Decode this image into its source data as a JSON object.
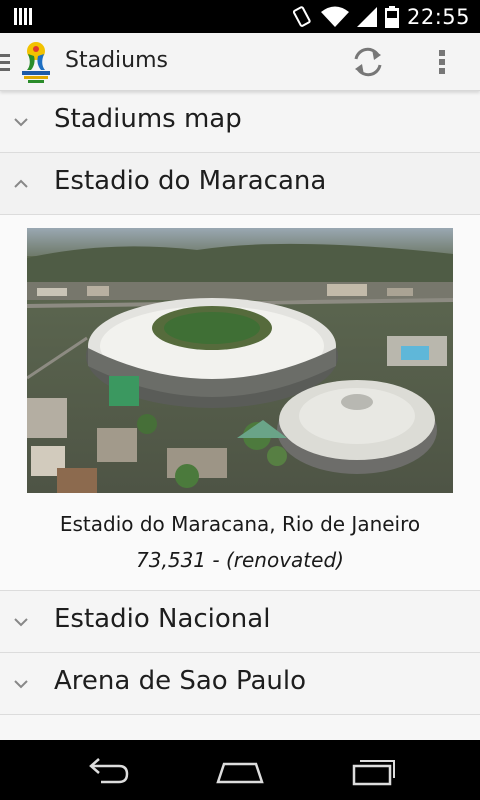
{
  "status_bar": {
    "time": "22:55",
    "icons": [
      "notification-icon",
      "vibrate-icon",
      "wifi-icon",
      "signal-icon",
      "battery-icon"
    ]
  },
  "action_bar": {
    "title": "Stadiums",
    "logo_icon": "fifa-world-cup-logo",
    "actions": [
      "refresh-icon",
      "overflow-menu-icon"
    ]
  },
  "stadiums": {
    "items": [
      {
        "label": "Stadiums map",
        "expanded": false
      },
      {
        "label": "Estadio do Maracana",
        "expanded": true
      },
      {
        "label": "Estadio Nacional",
        "expanded": false
      },
      {
        "label": "Arena de Sao Paulo",
        "expanded": false
      }
    ],
    "detail": {
      "caption": "Estadio do Maracana, Rio de Janeiro",
      "capacity": "73,531 - (renovated)"
    }
  },
  "nav_bar": {
    "buttons": [
      "back-icon",
      "home-icon",
      "recent-apps-icon"
    ]
  }
}
